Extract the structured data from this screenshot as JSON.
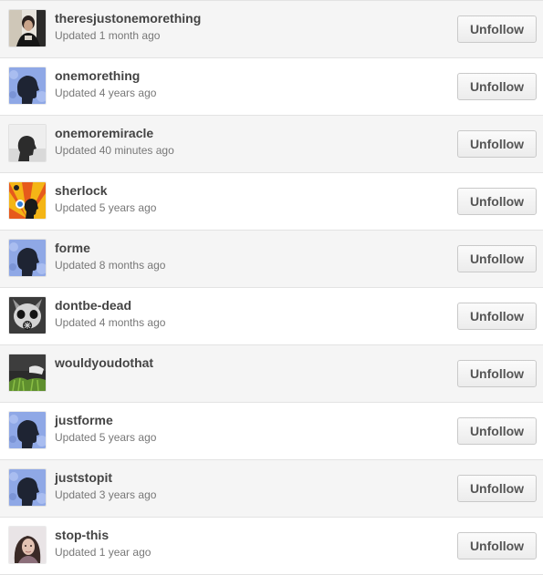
{
  "button_label": "Unfollow",
  "blogs": [
    {
      "name": "theresjustonemorething",
      "updated": "Updated 1 month ago",
      "avatar": "photo-man-icon"
    },
    {
      "name": "onemorething",
      "updated": "Updated 4 years ago",
      "avatar": "default-silhouette-icon"
    },
    {
      "name": "onemoremiracle",
      "updated": "Updated 40 minutes ago",
      "avatar": "gray-silhouette-photo"
    },
    {
      "name": "sherlock",
      "updated": "Updated 5 years ago",
      "avatar": "sherlock-sunburst-icon"
    },
    {
      "name": "forme",
      "updated": "Updated 8 months ago",
      "avatar": "default-silhouette-icon"
    },
    {
      "name": "dontbe-dead",
      "updated": "Updated 4 months ago",
      "avatar": "skull-icon"
    },
    {
      "name": "wouldyoudothat",
      "updated": "",
      "avatar": "grass-photo"
    },
    {
      "name": "justforme",
      "updated": "Updated 5 years ago",
      "avatar": "default-silhouette-icon"
    },
    {
      "name": "juststopit",
      "updated": "Updated 3 years ago",
      "avatar": "default-silhouette-icon"
    },
    {
      "name": "stop-this",
      "updated": "Updated 1 year ago",
      "avatar": "photo-woman-icon"
    }
  ]
}
